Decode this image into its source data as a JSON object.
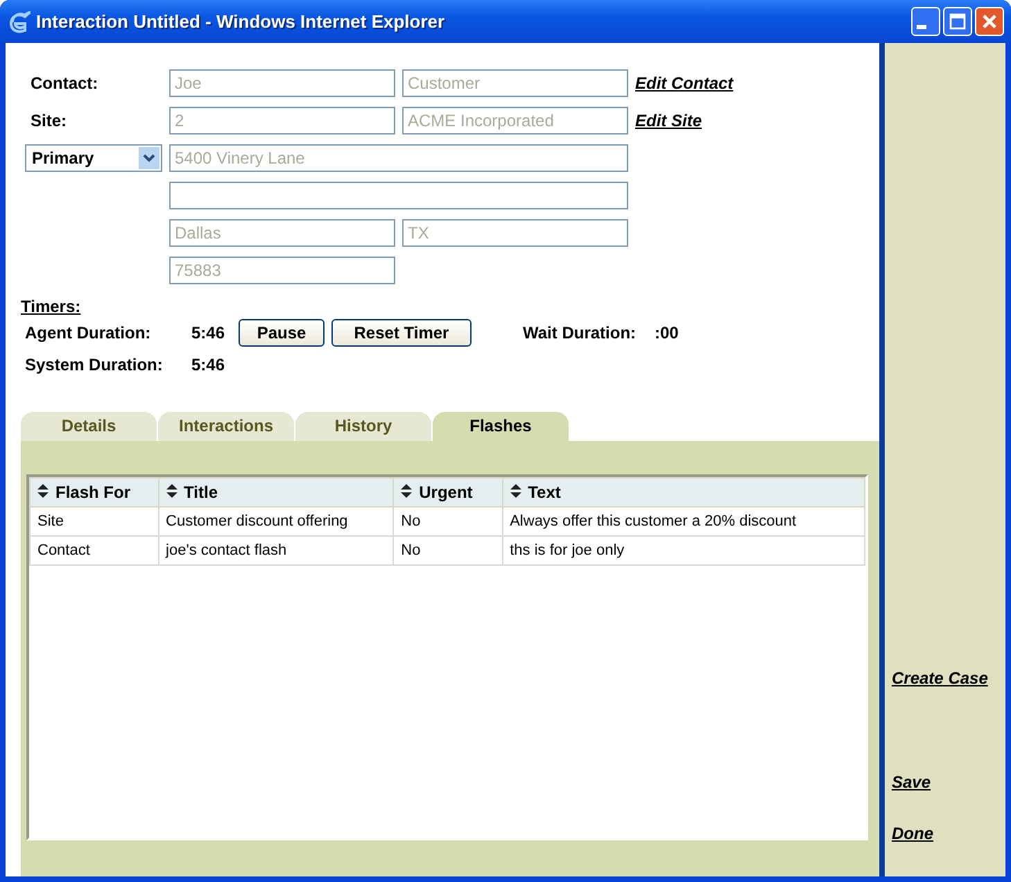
{
  "window": {
    "title": "Interaction Untitled - Windows Internet Explorer"
  },
  "contact": {
    "label": "Contact:",
    "first_name": "Joe",
    "last_name": "Customer",
    "link": "Edit Contact"
  },
  "site": {
    "label": "Site:",
    "number": "2",
    "name": "ACME Incorporated",
    "link": "Edit Site"
  },
  "address": {
    "type": "Primary",
    "line1": "5400 Vinery Lane",
    "city": "Dallas",
    "state": "TX",
    "zip": "75883"
  },
  "timers": {
    "heading": "Timers:",
    "agent_label": "Agent Duration:",
    "agent_value": "5:46",
    "system_label": "System Duration:",
    "system_value": "5:46",
    "wait_label": "Wait Duration:",
    "wait_value": ":00",
    "buttons": [
      "Pause",
      "Reset Timer"
    ]
  },
  "tabs": [
    {
      "label": "Details",
      "selected": false
    },
    {
      "label": "Interactions",
      "selected": false
    },
    {
      "label": "History",
      "selected": false
    },
    {
      "label": "Flashes",
      "selected": true
    }
  ],
  "table": {
    "columns": [
      "Flash For",
      "Title",
      "Urgent",
      "Text"
    ],
    "rows": [
      [
        "Site",
        "Customer discount offering",
        "No",
        "Always offer this customer a 20% discount"
      ],
      [
        "Contact",
        "joe's contact flash",
        "No",
        "ths is for joe only"
      ]
    ]
  },
  "sidebar": {
    "links": [
      "Create Case",
      "Save",
      "Done"
    ]
  }
}
